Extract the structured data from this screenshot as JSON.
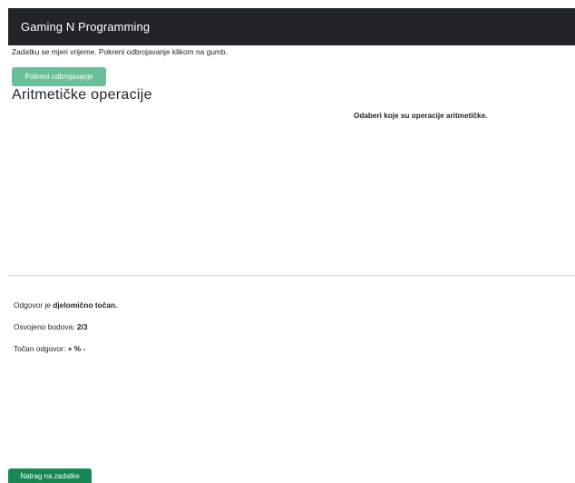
{
  "navbar": {
    "brand": "Gaming N Programming"
  },
  "timer": {
    "note": "Zadatku se mjeri vrijeme. Pokreni odbrojavanje klikom na gumb.",
    "start_button_label": "Pokreni odbrojavanje"
  },
  "task": {
    "title": "Aritmetičke operacije",
    "question": "Odaberi koje su operacije aritmetičke."
  },
  "result": {
    "answer_prefix": "Odgovor je ",
    "answer_status": "djelomično točan.",
    "points_label": "Osvojeno bodova: ",
    "points_value": "2/3",
    "correct_label": "Točan odgovor: ",
    "correct_value": "+ % -"
  },
  "footer": {
    "back_button_label": "Natrag na zadatke"
  },
  "colors": {
    "navbar_bg": "#212529",
    "start_button_bg": "#6bbf96",
    "back_button_bg": "#198754"
  }
}
